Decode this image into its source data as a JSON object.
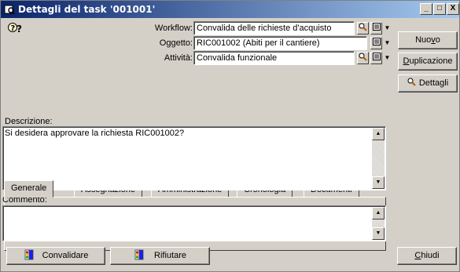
{
  "window": {
    "title": "Dettagli del task '001001'",
    "controls": {
      "minimize": "_",
      "maximize": "□",
      "close": "X"
    }
  },
  "form": {
    "workflow_label": "Workflow:",
    "workflow_value": "Convalida delle richieste d'acquisto",
    "oggetto_label": "Oggetto:",
    "oggetto_value": "RIC001002 (Abiti per il cantiere)",
    "attivita_label": "Attività:",
    "attivita_value": "Convalida funzionale"
  },
  "side_buttons": {
    "nuovo_pre": "Nuo",
    "nuovo_u": "v",
    "nuovo_post": "o",
    "duplicazione_u": "D",
    "duplicazione_post": "uplicazione",
    "dettagli": "Dettagli",
    "chiudi_u": "C",
    "chiudi_post": "hiudi"
  },
  "tabs": [
    "Generale",
    "Assegnazione",
    "Amministrazione",
    "Cronologia",
    "Documenti"
  ],
  "general": {
    "descrizione_label": "Descrizione:",
    "descrizione_text": "Si desidera approvare la richiesta RIC001002?",
    "commento_label": "Commento:",
    "commento_text": ""
  },
  "bottom_buttons": {
    "convalidare": "Convalidare",
    "rifiutare": "Rifiutare"
  },
  "colors": {
    "title_start": "#0a246a",
    "title_end": "#a6caf0",
    "face": "#d4d0c8"
  }
}
